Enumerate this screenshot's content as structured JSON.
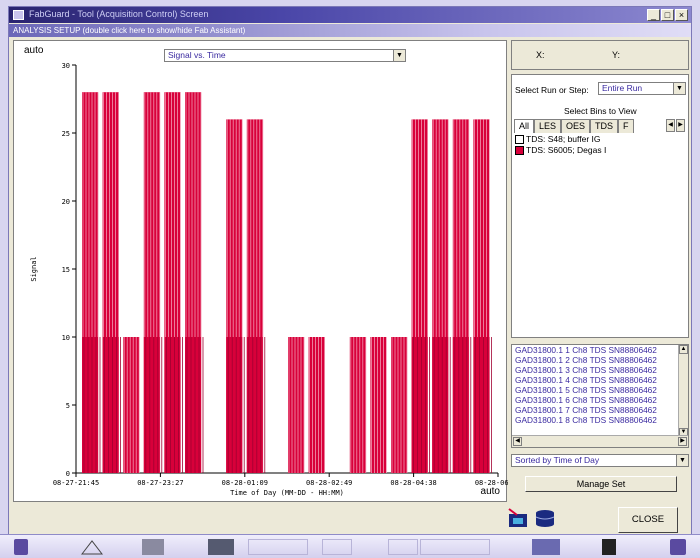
{
  "window": {
    "title": "FabGuard - Tool (Acquisition Control) Screen",
    "buttons": [
      "_",
      "□",
      "×"
    ]
  },
  "banner": "ANALYSIS SETUP (double click here to show/hide Fab Assistant)",
  "plot": {
    "auto_top": "auto",
    "auto_bottom": "auto",
    "view_selector": "Signal vs. Time"
  },
  "chart_data": {
    "type": "bar",
    "ylabel": "Signal",
    "xlabel": "Time of Day (MM-DD - HH:MM)",
    "ylim": [
      0,
      30
    ],
    "yticks": [
      "0",
      "5",
      "10",
      "15",
      "20",
      "25",
      "30"
    ],
    "xticks": [
      "08-27-21:45",
      "08-27-23:27",
      "08-28-01:09",
      "08-28-02:49",
      "08-28-04:38",
      "08-28-06:12"
    ],
    "colors": {
      "main": "#d8003a",
      "light": "#f29ab2",
      "dark": "#a00030"
    },
    "legend_placement": "none",
    "grid": false,
    "series": [
      {
        "name": "TDS: S6005; Degas I",
        "values": [
          28,
          28,
          10,
          28,
          28,
          28,
          0,
          26,
          26,
          0,
          10,
          10,
          0,
          10,
          10,
          10,
          26,
          26,
          26,
          26
        ]
      }
    ]
  },
  "side": {
    "x_label": "X:",
    "y_label": "Y:",
    "run_label": "Select Run or Step:",
    "run_value": "Entire Run",
    "bins_title": "Select Bins to View",
    "tabs": [
      "All",
      "LES",
      "OES",
      "TDS",
      "F"
    ],
    "bins": [
      {
        "label": "TDS: S48; buffer IG",
        "color": "#ffffff"
      },
      {
        "label": "TDS: S6005; Degas I",
        "color": "#d8003a"
      }
    ],
    "files": [
      "GAD31800.1 1 Ch8 TDS SN88806462",
      "GAD31800.1 2 Ch8 TDS SN88806462",
      "GAD31800.1 3 Ch8 TDS SN88806462",
      "GAD31800.1 4 Ch8 TDS SN88806462",
      "GAD31800.1 5 Ch8 TDS SN88806462",
      "GAD31800.1 6 Ch8 TDS SN88806462",
      "GAD31800.1 7 Ch8 TDS SN88806462",
      "GAD31800.1 8 Ch8 TDS SN88806462"
    ],
    "sort_value": "Sorted by Time of Day",
    "manage_label": "Manage Set"
  },
  "footer": {
    "close_label": "CLOSE"
  }
}
